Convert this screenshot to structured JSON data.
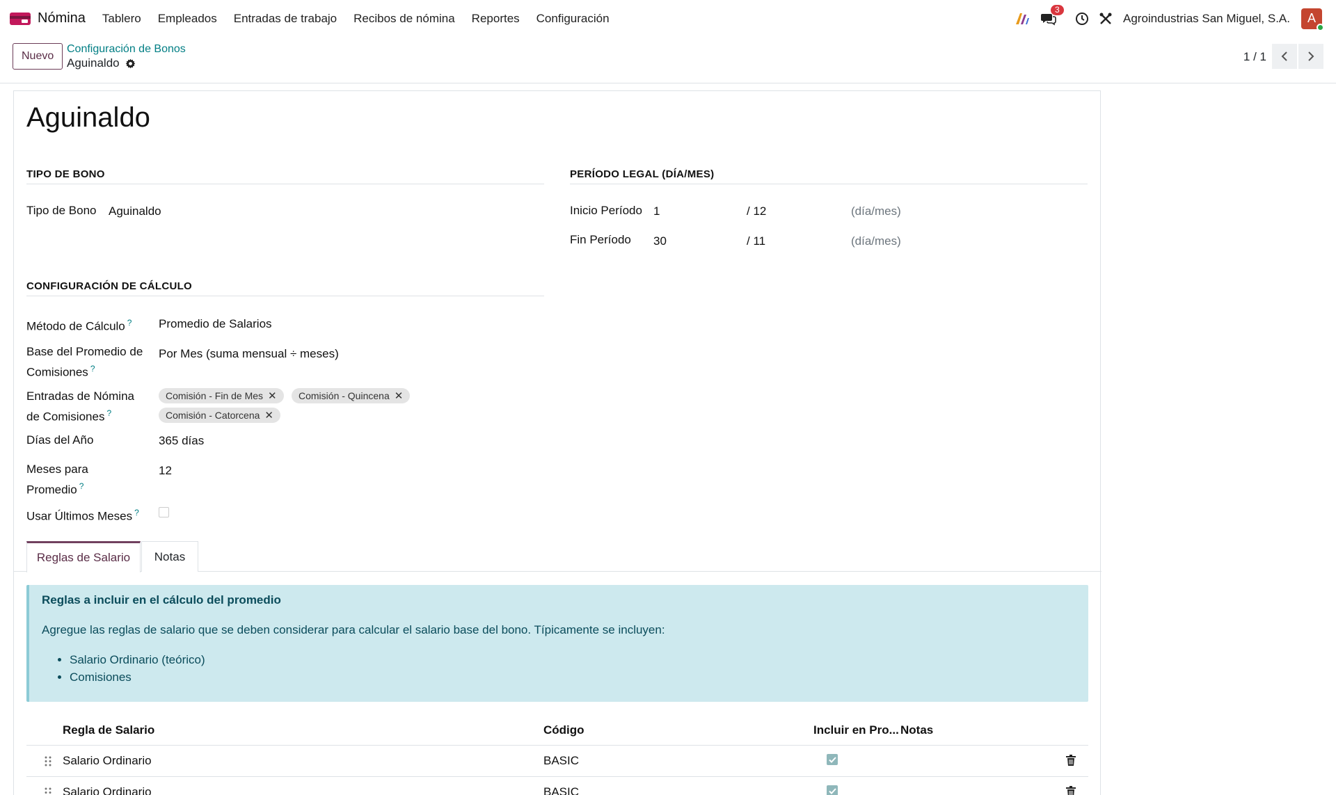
{
  "navbar": {
    "app_name": "Nómina",
    "menu": [
      "Tablero",
      "Empleados",
      "Entradas de trabajo",
      "Recibos de nómina",
      "Reportes",
      "Configuración"
    ],
    "messages_count": "3",
    "company": "Agroindustrias San Miguel, S.A.",
    "avatar_letter": "A",
    "accent_color": "#71405f"
  },
  "control_panel": {
    "new_label": "Nuevo",
    "breadcrumb_parent": "Configuración de Bonos",
    "breadcrumb_current": "Aguinaldo",
    "pager": "1 / 1"
  },
  "form": {
    "title": "Aguinaldo",
    "tipo_section": "TIPO DE BONO",
    "tipo_label": "Tipo de Bono",
    "tipo_value": "Aguinaldo",
    "periodo_section": "PERÍODO LEGAL (DÍA/MES)",
    "inicio_label": "Inicio Período",
    "inicio_day": "1",
    "inicio_month": "/ 12",
    "fin_label": "Fin Período",
    "fin_day": "30",
    "fin_month": "/ 11",
    "unit_hint": "(día/mes)",
    "calc_section": "CONFIGURACIÓN DE CÁLCULO",
    "metodo_label": "Método de Cálculo",
    "metodo_value": "Promedio de Salarios",
    "base_label_1": "Base del Promedio de",
    "base_label_2": "Comisiones",
    "base_value": "Por Mes (suma mensual ÷ meses)",
    "entradas_label_1": "Entradas de Nómina",
    "entradas_label_2": "de Comisiones",
    "entradas_tags": [
      "Comisión - Fin de Mes",
      "Comisión - Quincena",
      "Comisión - Catorcena"
    ],
    "dias_label": "Días del Año",
    "dias_value": "365 días",
    "meses_label_1": "Meses para",
    "meses_label_2": "Promedio",
    "meses_value": "12",
    "usar_label": "Usar Últimos Meses",
    "usar_checked": false,
    "help_mark": "?"
  },
  "tabs": [
    "Reglas de Salario",
    "Notas"
  ],
  "alert": {
    "title": "Reglas a incluir en el cálculo del promedio",
    "text": "Agregue las reglas de salario que se deben considerar para calcular el salario base del bono. Típicamente se incluyen:",
    "items": [
      "Salario Ordinario (teórico)",
      "Comisiones"
    ]
  },
  "table": {
    "columns": [
      "Regla de Salario",
      "Código",
      "Incluir en Pro...",
      "Notas"
    ],
    "rows": [
      {
        "regla": "Salario Ordinario",
        "codigo": "BASIC",
        "incluir": true,
        "notas": ""
      },
      {
        "regla": "Salario Ordinario",
        "codigo": "BASIC",
        "incluir": true,
        "notas": ""
      }
    ]
  }
}
